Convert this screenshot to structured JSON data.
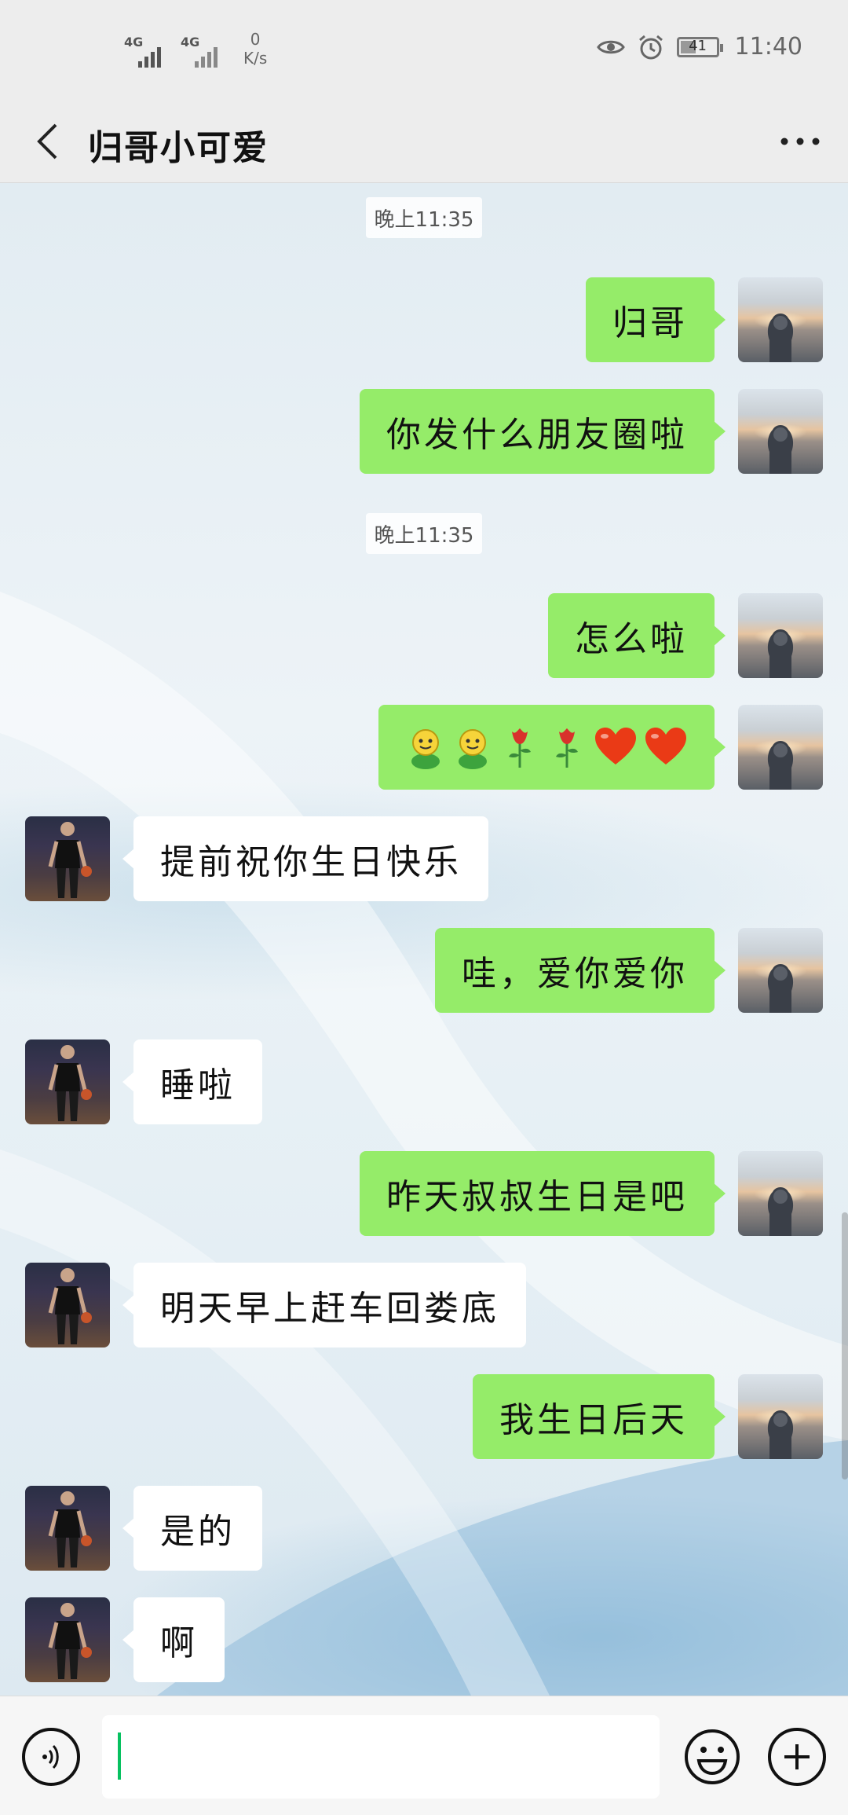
{
  "status_bar": {
    "signal1_label": "4G",
    "signal2_label": "4G",
    "net_speed_value": "0",
    "net_speed_unit": "K/s",
    "battery_level": "41",
    "time": "11:40",
    "icons": [
      "eye-icon",
      "alarm-icon",
      "battery-icon"
    ]
  },
  "header": {
    "title": "归哥小可爱",
    "back_icon": "chevron-left-icon",
    "more_icon": "more-dots-icon"
  },
  "messages": [
    {
      "type": "timestamp",
      "text": "晚上11:35"
    },
    {
      "type": "sent",
      "text": "归哥"
    },
    {
      "type": "sent",
      "text": "你发什么朋友圈啦"
    },
    {
      "type": "timestamp",
      "text": "晚上11:35"
    },
    {
      "type": "sent",
      "text": "怎么啦"
    },
    {
      "type": "sent",
      "emojis": [
        "smiley-sprout-icon",
        "smiley-sprout-icon",
        "rose-icon",
        "rose-icon",
        "heart-icon",
        "heart-icon"
      ]
    },
    {
      "type": "received",
      "text": "提前祝你生日快乐"
    },
    {
      "type": "sent",
      "text": "哇，爱你爱你"
    },
    {
      "type": "received",
      "text": "睡啦"
    },
    {
      "type": "sent",
      "text": "昨天叔叔生日是吧"
    },
    {
      "type": "received",
      "text": "明天早上赶车回娄底"
    },
    {
      "type": "sent",
      "text": "我生日后天"
    },
    {
      "type": "received",
      "text": "是的"
    },
    {
      "type": "received",
      "text": "啊"
    }
  ],
  "input_bar": {
    "voice_icon": "voice-icon",
    "input_value": "",
    "emoji_icon": "emoji-icon",
    "plus_icon": "plus-icon"
  },
  "colors": {
    "sent_bubble": "#95ec69",
    "received_bubble": "#ffffff",
    "bar_background": "#ededed",
    "caret": "#07c160"
  }
}
